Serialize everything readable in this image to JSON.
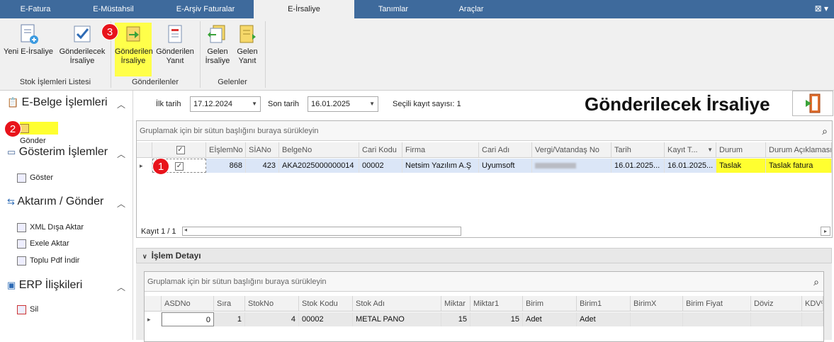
{
  "tabs": [
    "E-Fatura",
    "E-Müstahsil",
    "E-Arşiv Faturalar",
    "E-İrsaliye",
    "Tanımlar",
    "Araçlar"
  ],
  "active_tab": "E-İrsaliye",
  "window_controls": "⊠ ▾",
  "ribbon": {
    "stok": {
      "yeni": "Yeni E-İrsaliye",
      "gonderilecek": "Gönderilecek İrsaliye",
      "group": "Stok İşlemleri Listesi"
    },
    "gonderilenler": {
      "irsaliye": "Gönderilen İrsaliye",
      "yanit": "Gönderilen Yanıt",
      "group": "Gönderilenler"
    },
    "gelenler": {
      "irsaliye": "Gelen İrsaliye",
      "yanit": "Gelen Yanıt",
      "group": "Gelenler"
    }
  },
  "badges": {
    "one": "1",
    "two": "2",
    "three": "3"
  },
  "sidebar": {
    "ebelge": {
      "title": "E-Belge İşlemleri",
      "items": [
        "Gönder"
      ]
    },
    "gosterim": {
      "title": "Gösterim İşlemler",
      "items": [
        "Göster"
      ]
    },
    "aktarim": {
      "title": "Aktarım / Gönder",
      "items": [
        "XML Dışa Aktar",
        "Exele Aktar",
        "Toplu Pdf İndir"
      ]
    },
    "erp": {
      "title": "ERP İlişkileri",
      "items": [
        "Sil"
      ]
    }
  },
  "filters": {
    "ilk_label": "İlk tarih",
    "ilk_value": "17.12.2024",
    "son_label": "Son tarih",
    "son_value": "16.01.2025",
    "secili_label": "Seçili kayıt sayısı: 1"
  },
  "page_title": "Gönderilecek İrsaliye",
  "main_grid": {
    "group_hint": "Gruplamak için bir sütun başlığını buraya sürükleyin",
    "columns": [
      "",
      "EİşlemNo",
      "SİANo",
      "BelgeNo",
      "Cari Kodu",
      "Firma",
      "Cari Adı",
      "Vergi/Vatandaş No",
      "Tarih",
      "Kayıt T...",
      "Durum",
      "Durum Açıklaması"
    ],
    "row": {
      "check": "✓",
      "eislemno": "868",
      "siano": "423",
      "belgeno": "AKA2025000000014",
      "cari_kodu": "00002",
      "firma": "Netsim Yazılım A.Ş",
      "cari_adi": "Uyumsoft",
      "vergi": "",
      "tarih": "16.01.2025...",
      "kayit": "16.01.2025...",
      "durum": "Taslak",
      "durum_aciklama": "Taslak fatura"
    },
    "footer": "Kayıt 1 / 1"
  },
  "detail": {
    "title": "İşlem Detayı",
    "group_hint": "Gruplamak için bir sütun başlığını buraya sürükleyin",
    "columns": [
      "ASDNo",
      "Sıra",
      "StokNo",
      "Stok Kodu",
      "Stok Adı",
      "Miktar",
      "Miktar1",
      "Birim",
      "Birim1",
      "BirimX",
      "Birim Fiyat",
      "Döviz",
      "KDV%"
    ],
    "row": {
      "asdno": "0",
      "sira": "1",
      "stokno": "4",
      "stok_kodu": "00002",
      "stok_adi": "METAL PANO",
      "miktar": "15",
      "miktar1": "15",
      "birim": "Adet",
      "birim1": "Adet"
    }
  },
  "colors": {
    "tabbar": "#3e6a9c",
    "highlight": "#ffff30",
    "badge": "#e8131b",
    "selected_row": "#dbe6f7"
  }
}
